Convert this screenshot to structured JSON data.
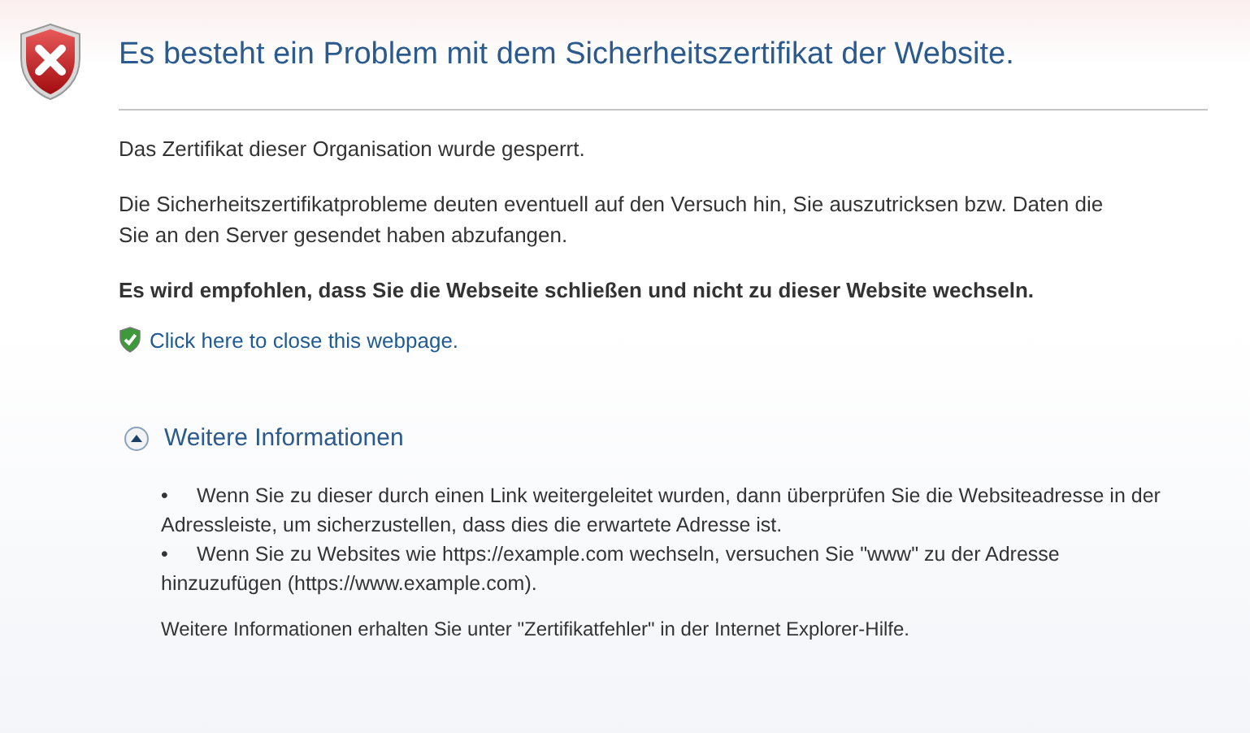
{
  "title": "Es besteht ein Problem mit dem Sicherheitszertifikat der Website.",
  "paragraphs": [
    {
      "text": "Das Zertifikat dieser Organisation wurde gesperrt.",
      "bold": false
    },
    {
      "text": "Die Sicherheitszertifikatprobleme deuten eventuell auf den Versuch hin, Sie auszutricksen bzw. Daten die Sie an den Server gesendet haben abzufangen.",
      "bold": false
    },
    {
      "text": "Es wird empfohlen, dass Sie die Webseite schließen und nicht zu dieser Website wechseln.",
      "bold": true
    }
  ],
  "close_link": "Click here to close this webpage.",
  "more_info": {
    "label": "Weitere Informationen",
    "expanded": true,
    "items": [
      {
        "marker": "•",
        "text": "Wenn Sie zu dieser durch einen Link weitergeleitet wurden, dann überprüfen Sie die Websiteadresse in der Adressleiste, um sicherzustellen, dass dies die erwartete Adresse ist."
      },
      {
        "marker": "•",
        "text": "Wenn Sie zu Websites wie https://example.com wechseln, versuchen Sie \"www\" zu der Adresse hinzuzufügen (https://www.example.com)."
      }
    ],
    "footer": "Weitere Informationen erhalten Sie unter \"Zertifikatfehler\" in der Internet Explorer-Hilfe."
  }
}
